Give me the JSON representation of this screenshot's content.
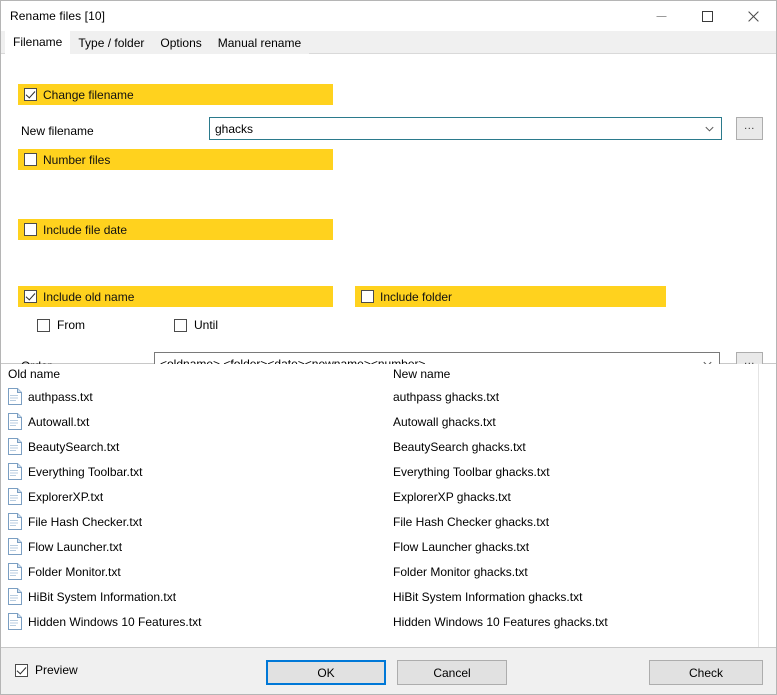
{
  "window": {
    "title": "Rename files [10]",
    "controls": {
      "minimize": "minimize-icon",
      "maximize": "maximize-icon",
      "close": "close-icon"
    }
  },
  "tabs": [
    {
      "label": "Filename",
      "active": true
    },
    {
      "label": "Type / folder",
      "active": false
    },
    {
      "label": "Options",
      "active": false
    },
    {
      "label": "Manual rename",
      "active": false
    }
  ],
  "form": {
    "change_filename": {
      "label": "Change filename",
      "checked": true
    },
    "new_filename_label": "New filename",
    "new_filename_value": "ghacks",
    "new_filename_browse": "...",
    "number_files": {
      "label": "Number files",
      "checked": false
    },
    "include_file_date": {
      "label": "Include file date",
      "checked": false
    },
    "include_old_name": {
      "label": "Include old name",
      "checked": true
    },
    "include_folder": {
      "label": "Include folder",
      "checked": false
    },
    "from": {
      "label": "From",
      "checked": false
    },
    "until": {
      "label": "Until",
      "checked": false
    },
    "order_label": "Order",
    "order_value": "<oldname> <folder><date><newname><number>",
    "order_browse": "..."
  },
  "list": {
    "headers": {
      "old": "Old name",
      "new": "New name"
    },
    "rows": [
      {
        "old": "authpass.txt",
        "new": "authpass ghacks.txt"
      },
      {
        "old": "Autowall.txt",
        "new": "Autowall ghacks.txt"
      },
      {
        "old": "BeautySearch.txt",
        "new": "BeautySearch ghacks.txt"
      },
      {
        "old": "Everything Toolbar.txt",
        "new": "Everything Toolbar ghacks.txt"
      },
      {
        "old": "ExplorerXP.txt",
        "new": "ExplorerXP ghacks.txt"
      },
      {
        "old": "File Hash Checker.txt",
        "new": "File Hash Checker ghacks.txt"
      },
      {
        "old": "Flow Launcher.txt",
        "new": "Flow Launcher ghacks.txt"
      },
      {
        "old": "Folder Monitor.txt",
        "new": "Folder Monitor ghacks.txt"
      },
      {
        "old": "HiBit System Information.txt",
        "new": "HiBit System Information ghacks.txt"
      },
      {
        "old": "Hidden Windows 10 Features.txt",
        "new": "Hidden Windows 10 Features ghacks.txt"
      }
    ]
  },
  "footer": {
    "preview": {
      "label": "Preview",
      "checked": true
    },
    "ok": "OK",
    "cancel": "Cancel",
    "check": "Check"
  },
  "colors": {
    "highlight_yellow": "#FFD21E",
    "accent_blue": "#0078d7",
    "focus_border": "#2b7a8c"
  }
}
